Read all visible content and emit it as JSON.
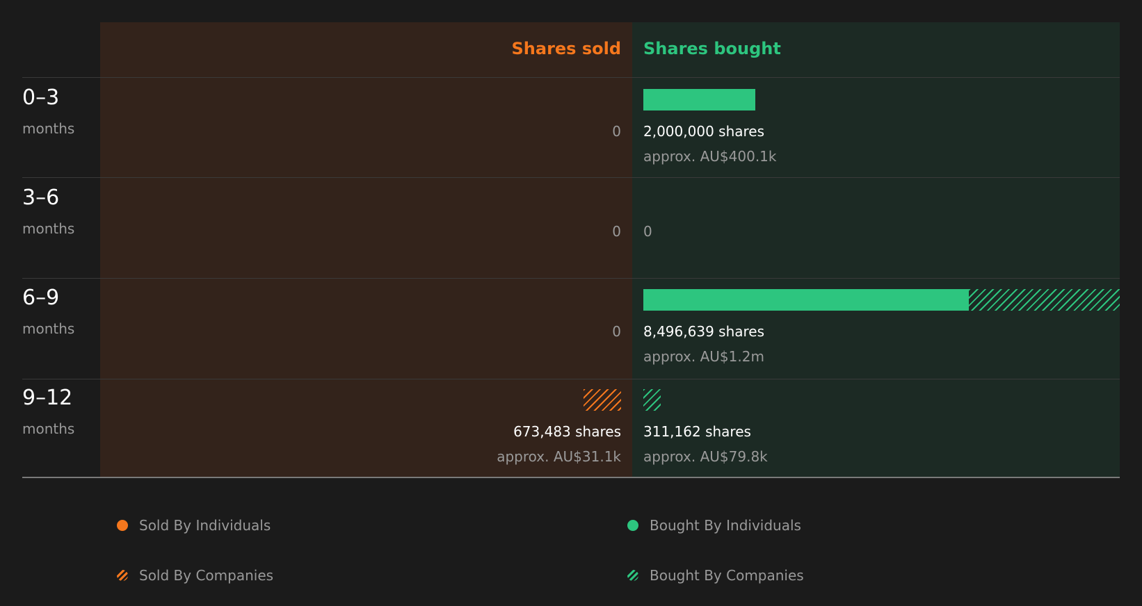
{
  "chart_data": {
    "type": "bar",
    "headers": {
      "sold": "Shares sold",
      "bought": "Shares bought"
    },
    "colors": {
      "sold": "#f5771d",
      "bought": "#2dc57f"
    },
    "periods": [
      {
        "label": "0–3",
        "unit": "months",
        "sold": {
          "text": "0",
          "individuals": 0,
          "companies": 0
        },
        "bought": {
          "shares_text": "2,000,000 shares",
          "approx_text": "approx. AU$400.1k",
          "individuals": 2000000,
          "companies": 0
        }
      },
      {
        "label": "3–6",
        "unit": "months",
        "sold": {
          "text": "0",
          "individuals": 0,
          "companies": 0
        },
        "bought": {
          "text": "0",
          "individuals": 0,
          "companies": 0
        }
      },
      {
        "label": "6–9",
        "unit": "months",
        "sold": {
          "text": "0",
          "individuals": 0,
          "companies": 0
        },
        "bought": {
          "shares_text": "8,496,639 shares",
          "approx_text": "approx. AU$1.2m",
          "individuals": 5800000,
          "companies": 2696639
        }
      },
      {
        "label": "9–12",
        "unit": "months",
        "sold": {
          "shares_text": "673,483 shares",
          "approx_text": "approx. AU$31.1k",
          "individuals": 0,
          "companies": 673483
        },
        "bought": {
          "shares_text": "311,162 shares",
          "approx_text": "approx. AU$79.8k",
          "individuals": 0,
          "companies": 311162
        }
      }
    ],
    "legend": {
      "sold_individuals": "Sold By Individuals",
      "sold_companies": "Sold By Companies",
      "bought_individuals": "Bought By Individuals",
      "bought_companies": "Bought By Companies"
    }
  }
}
